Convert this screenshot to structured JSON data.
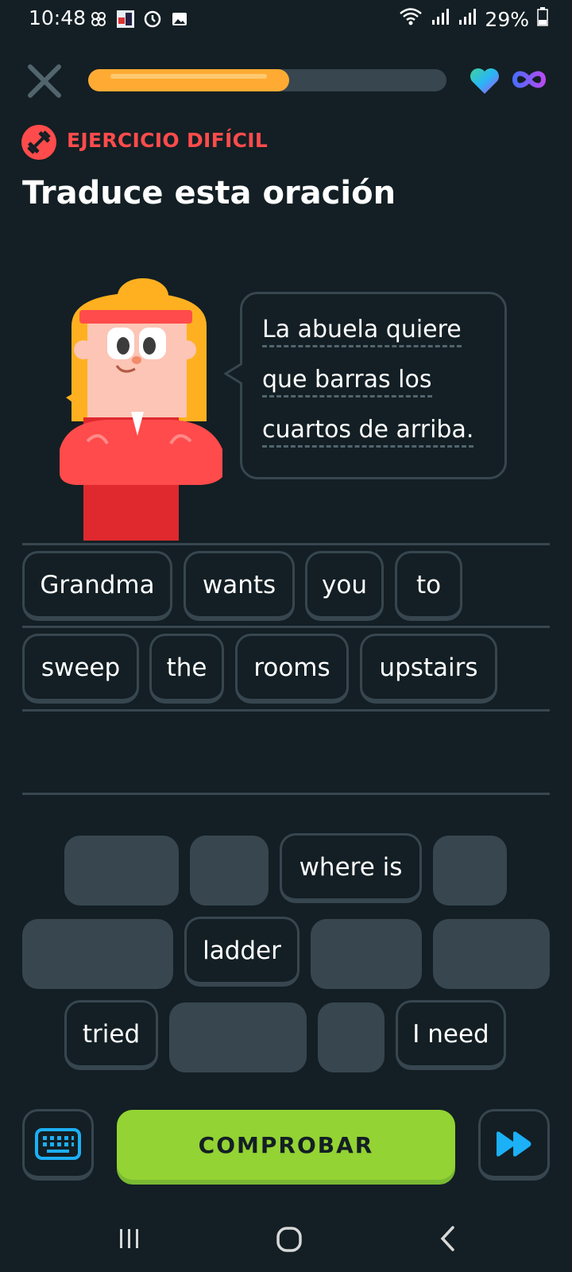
{
  "status_bar": {
    "time": "10:48",
    "battery": "29%"
  },
  "header": {
    "progress": 0.56
  },
  "challenge": {
    "hard_label": "EJERCICIO DIFÍCIL",
    "title": "Traduce esta oración"
  },
  "prompt": {
    "lines": [
      "La abuela quiere",
      "que barras los",
      "cuartos de arriba."
    ]
  },
  "answer": {
    "row1": [
      "Grandma",
      "wants",
      "you",
      "to"
    ],
    "row2": [
      "sweep",
      "the",
      "rooms",
      "upstairs"
    ]
  },
  "word_bank": {
    "where_is": "where is",
    "ladder": "ladder",
    "tried": "tried",
    "i_need": "I need"
  },
  "actions": {
    "check_label": "COMPROBAR"
  },
  "colors": {
    "background": "#131f24",
    "accent_red": "#ff4b4b",
    "progress": "#ffab33",
    "check_green": "#93d333",
    "border": "#37464f"
  }
}
